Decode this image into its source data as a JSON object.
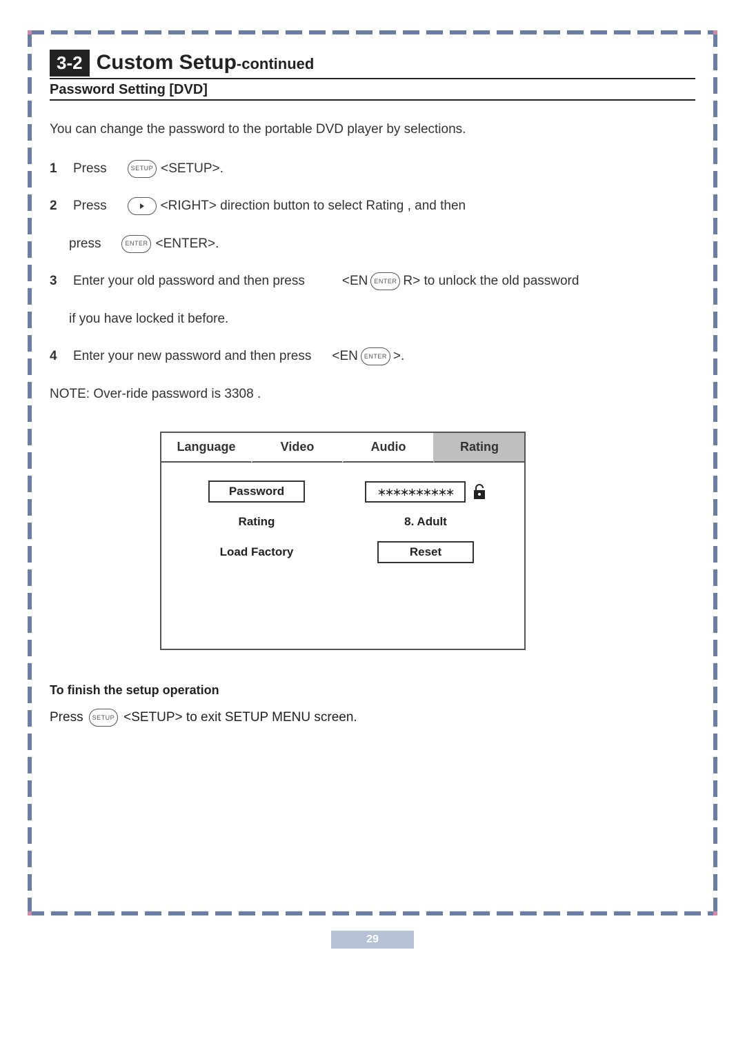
{
  "heading": {
    "section_number": "3-2",
    "title": "Custom Setup",
    "continued": "-continued"
  },
  "subheading": "Password Setting [DVD]",
  "intro": "You can change the password to the portable DVD player by selections.",
  "buttons": {
    "setup": "SETUP",
    "enter": "ENTER"
  },
  "steps": {
    "s1": {
      "n": "1",
      "press": "Press",
      "setup_tag": "<SETUP>."
    },
    "s2": {
      "n": "2",
      "press": "Press",
      "right_tag": "<RIGHT> direction button  to select  Rating , and then",
      "press2": "press",
      "enter_tag": "<ENTER>."
    },
    "s3": {
      "n": "3",
      "a": "Enter your old password and then press",
      "pre": "<EN",
      "post": "R> to unlock the old password",
      "c": "if you have locked it before."
    },
    "s4": {
      "n": "4",
      "a": "Enter your new password and then press",
      "pre": "<EN",
      "post": ">."
    }
  },
  "note": "NOTE: Over-ride password is  3308 .",
  "menu": {
    "tabs": {
      "language": "Language",
      "video": "Video",
      "audio": "Audio",
      "rating": "Rating"
    },
    "rows": {
      "password_label": "Password",
      "password_value": "＊＊＊＊＊＊＊＊＊＊",
      "rating_label": "Rating",
      "rating_value": "8. Adult",
      "factory_label": "Load Factory",
      "factory_value": "Reset"
    }
  },
  "finish": {
    "heading": "To finish the setup operation",
    "press": "Press",
    "text": "<SETUP>   to exit SETUP MENU screen."
  },
  "page_number": "29"
}
